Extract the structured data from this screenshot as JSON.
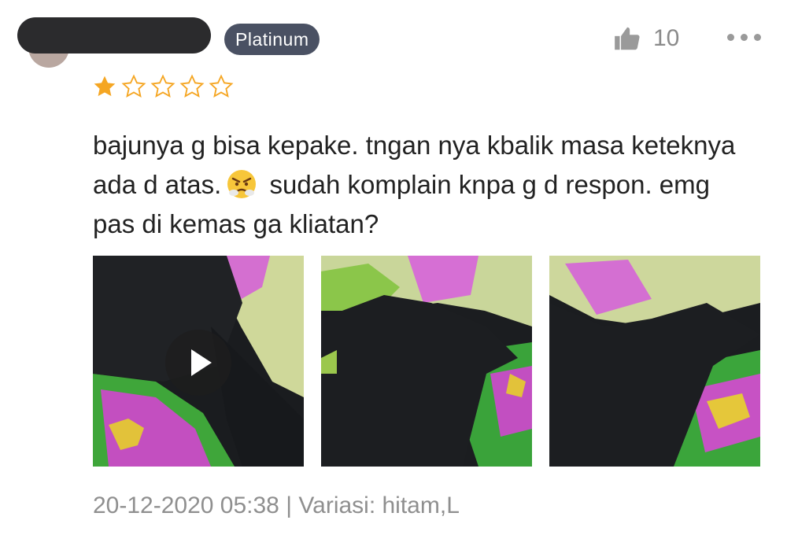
{
  "reviewer": {
    "badge": "Platinum"
  },
  "likes": {
    "count": "10",
    "icon": "thumbs-up-icon"
  },
  "more_icon": "more-options-icon",
  "rating": {
    "value": 1,
    "max": 5,
    "filled_color": "#f5a623",
    "empty_color": "#f5a623"
  },
  "review": {
    "text_before_emoji": "bajunya g bisa kepake. tngan nya kbalik masa keteknya ada d atas.",
    "emoji": "angry-face-icon",
    "text_after_emoji": "sudah komplain knpa g d respon. emg pas di kemas ga kliatan?"
  },
  "media": [
    {
      "type": "video",
      "icon": "play-icon"
    },
    {
      "type": "image"
    },
    {
      "type": "image"
    }
  ],
  "footer": {
    "date": "20-12-2020 05:38",
    "separator": "|",
    "variation": "Variasi: hitam,L"
  },
  "colors": {
    "badge_bg": "#4a5163",
    "meta_text": "#8f8f8f",
    "body_text": "#222222"
  }
}
